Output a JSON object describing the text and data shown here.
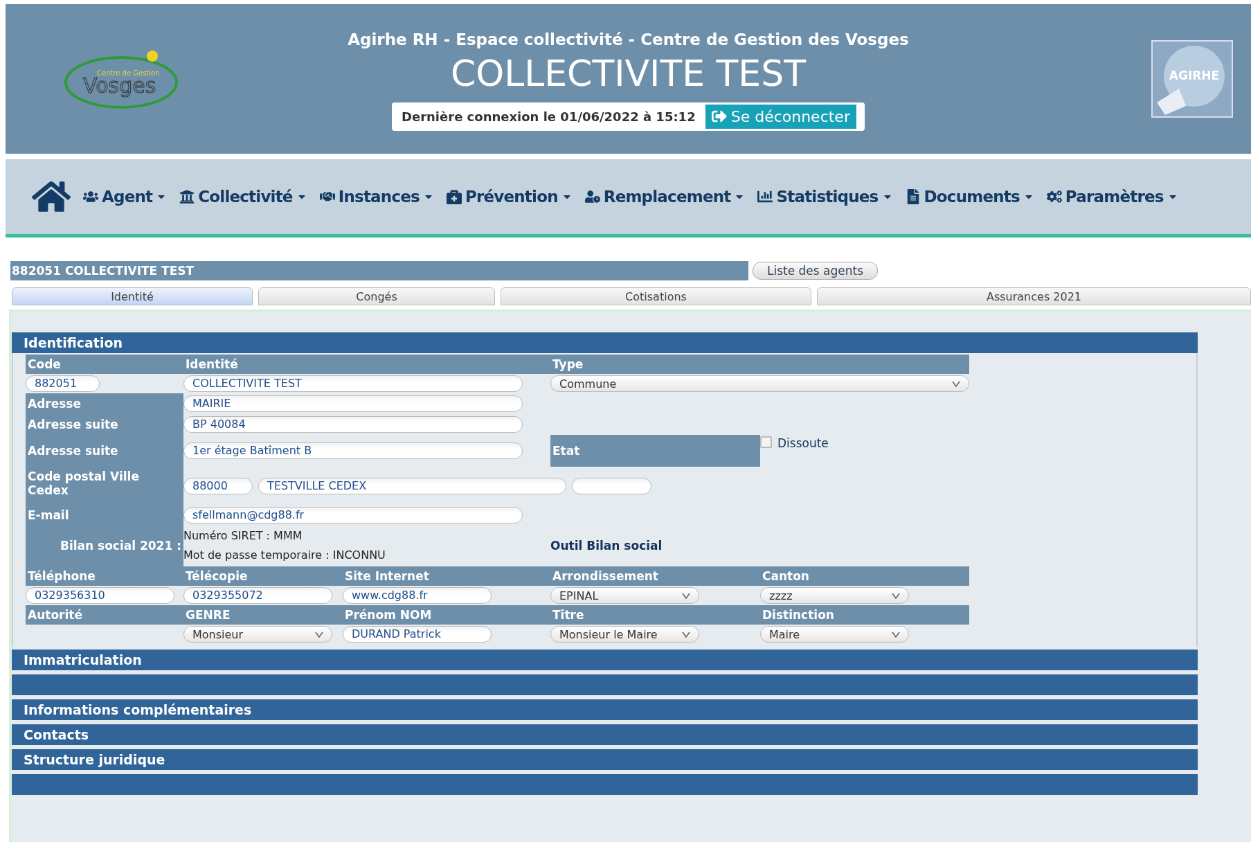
{
  "header": {
    "logo_title": "Vosges",
    "logo_subtitle": "Centre de Gestion",
    "subtitle": "Agirhe RH - Espace collectivité - Centre de Gestion des Vosges",
    "title": "COLLECTIVITE TEST",
    "last_login": "Dernière connexion le 01/06/2022 à 15:12",
    "logout_button": "Se déconnecter",
    "badge_text": "AGIRHE"
  },
  "nav": {
    "items": [
      {
        "label": "Agent"
      },
      {
        "label": "Collectivité"
      },
      {
        "label": "Instances"
      },
      {
        "label": "Prévention"
      },
      {
        "label": "Remplacement"
      },
      {
        "label": "Statistiques"
      },
      {
        "label": "Documents"
      },
      {
        "label": "Paramètres"
      }
    ]
  },
  "record_bar": {
    "title": "882051 COLLECTIVITE TEST",
    "button": "Liste des agents"
  },
  "tabs": [
    {
      "label": "Identité",
      "selected": true
    },
    {
      "label": "Congés",
      "selected": false
    },
    {
      "label": "Cotisations",
      "selected": false
    },
    {
      "label": "Assurances 2021",
      "selected": false
    }
  ],
  "identification": {
    "title": "Identification",
    "code": {
      "label": "Code",
      "value": "882051"
    },
    "identite": {
      "label": "Identité",
      "value": "COLLECTIVITE TEST"
    },
    "type": {
      "label": "Type",
      "value": "Commune"
    },
    "addresses": [
      {
        "label": "Adresse",
        "value": "MAIRIE"
      },
      {
        "label": "Adresse suite",
        "value": "BP 40084"
      },
      {
        "label": "Adresse suite",
        "value": "1er étage Batîment B"
      }
    ],
    "etat": {
      "label": "Etat",
      "option": "Dissoute",
      "checked": false
    },
    "postal": {
      "label": "Code postal Ville Cedex",
      "postal_code": "88000",
      "city": "TESTVILLE CEDEX"
    },
    "email": {
      "label": "E-mail",
      "value": "sfellmann@cdg88.fr"
    },
    "bilan": {
      "label": "Bilan social 2021 :",
      "lines": [
        "Numéro SIRET : MMM",
        "Mot de passe temporaire : INCONNU"
      ],
      "tool": "Outil Bilan social"
    },
    "field_rows": [
      [
        {
          "label": "Téléphone",
          "kind": "input",
          "value": "0329356310"
        },
        {
          "label": "Télécopie",
          "kind": "input",
          "value": "0329355072"
        },
        {
          "label": "Site Internet",
          "kind": "input",
          "value": "www.cdg88.fr"
        },
        {
          "label": "Arrondissement",
          "kind": "select",
          "value": "EPINAL"
        },
        {
          "label": "Canton",
          "kind": "select",
          "value": "zzzz"
        }
      ],
      [
        {
          "label": "Autorité",
          "kind": "none"
        },
        {
          "label": "GENRE",
          "kind": "select",
          "value": "Monsieur"
        },
        {
          "label": "Prénom NOM",
          "kind": "input",
          "value": "DURAND Patrick"
        },
        {
          "label": "Titre",
          "kind": "select",
          "value": "Monsieur le Maire"
        },
        {
          "label": "Distinction",
          "kind": "select",
          "value": "Maire"
        }
      ]
    ]
  },
  "sections": [
    {
      "kind": "titled",
      "title": "Immatriculation"
    },
    {
      "kind": "blank"
    },
    {
      "kind": "titled",
      "title": "Informations complémentaires"
    },
    {
      "kind": "titled",
      "title": "Contacts"
    },
    {
      "kind": "titled",
      "title": "Structure juridique"
    },
    {
      "kind": "blank"
    }
  ]
}
